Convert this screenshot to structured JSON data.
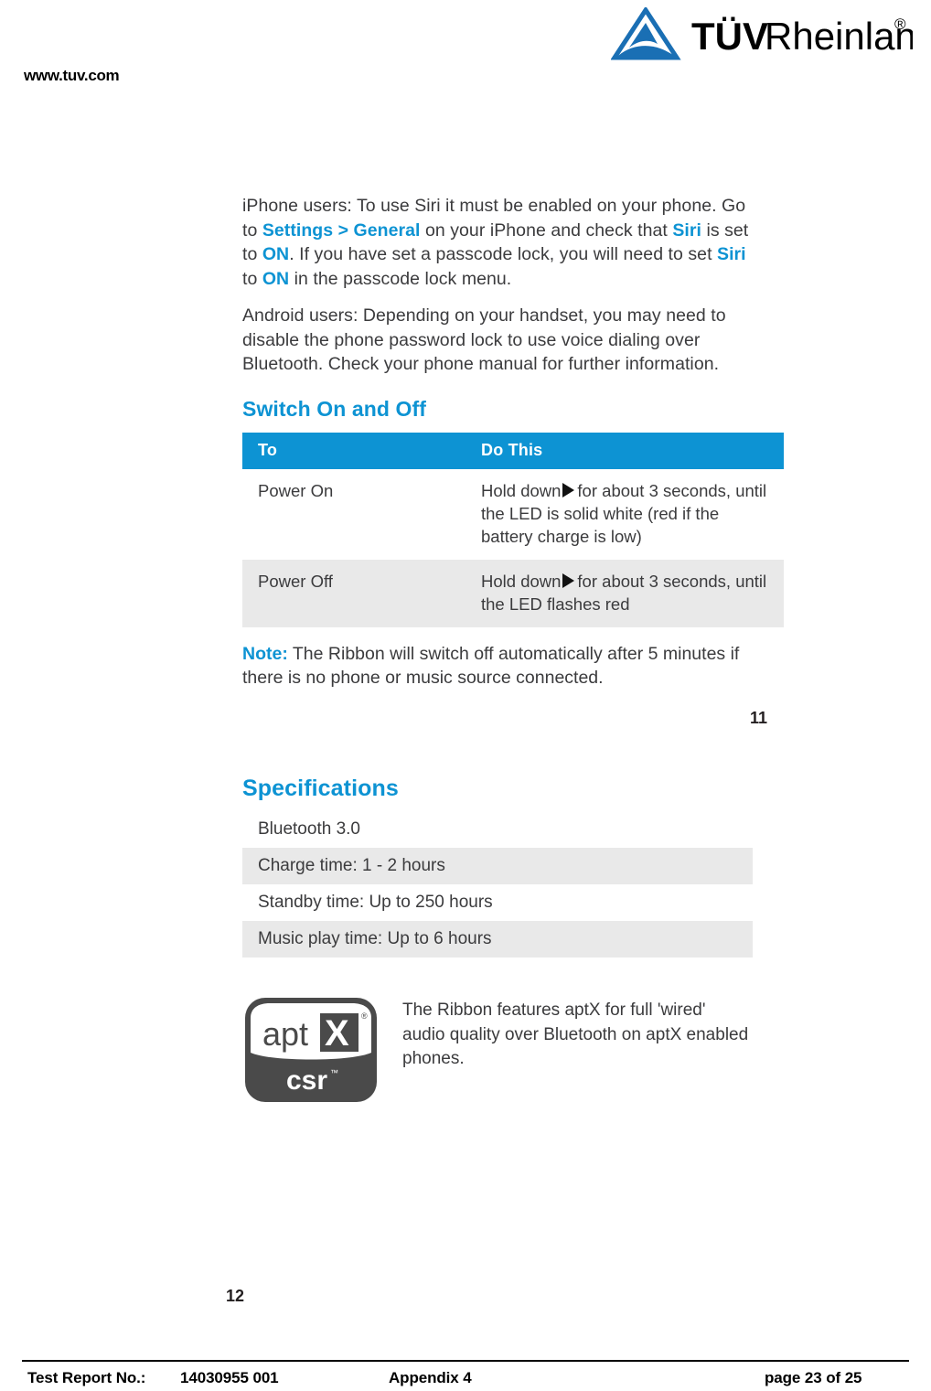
{
  "header": {
    "logo_alt": "TUV Rheinland",
    "logo_text_bold": "TÜV",
    "logo_text_regular": "Rheinland",
    "logo_registered": "®",
    "site_url": "www.tuv.com",
    "brand_color": "#1a6fb4"
  },
  "manual": {
    "accent_color": "#0d93d3",
    "shade_color": "#e9e9e9",
    "paragraphs": [
      {
        "id": "iphone-users",
        "runs": [
          {
            "text": "iPhone users: To use Siri it must be enabled on your phone. Go to ",
            "style": "normal"
          },
          {
            "text": "Settings > General",
            "style": "accent"
          },
          {
            "text": " on your iPhone and check that ",
            "style": "normal"
          },
          {
            "text": "Siri",
            "style": "accent"
          },
          {
            "text": " is set to ",
            "style": "normal"
          },
          {
            "text": "ON",
            "style": "accent"
          },
          {
            "text": ". If you have set a passcode lock, you will need to set ",
            "style": "normal"
          },
          {
            "text": "Siri",
            "style": "accent"
          },
          {
            "text": " to ",
            "style": "normal"
          },
          {
            "text": "ON",
            "style": "accent"
          },
          {
            "text": " in the passcode lock menu.",
            "style": "normal"
          }
        ]
      },
      {
        "id": "android-users",
        "runs": [
          {
            "text": "Android users: Depending on your handset, you may need to disable the phone password lock to use voice dialing over Bluetooth. Check your phone manual for further information.",
            "style": "normal"
          }
        ]
      }
    ],
    "switch_section": {
      "heading": "Switch On and Off",
      "columns": [
        "To",
        "Do This"
      ],
      "rows": [
        {
          "to": "Power On",
          "do_this_pre": "Hold down",
          "do_this_icon": "play-triangle-icon",
          "do_this_post": "for about 3 seconds, until the LED is solid white (red if the battery charge is low)"
        },
        {
          "to": "Power Off",
          "do_this_pre": "Hold down",
          "do_this_icon": "play-triangle-icon",
          "do_this_post": "for about 3 seconds, until the LED flashes red"
        }
      ]
    },
    "note": {
      "label": "Note:",
      "text": " The Ribbon will switch off automatically after 5 minutes if there is no phone or music source connected."
    },
    "folio_first": "11",
    "folio_second": "12"
  },
  "specifications": {
    "heading": "Specifications",
    "items": [
      {
        "text": "Bluetooth 3.0",
        "shaded": false
      },
      {
        "text": "Charge time: 1 - 2 hours",
        "shaded": true
      },
      {
        "text": "Standby time: Up to 250 hours",
        "shaded": false
      },
      {
        "text": "Music play time: Up to 6 hours",
        "shaded": true
      }
    ]
  },
  "aptx": {
    "logo_name": "aptx-csr-logo",
    "logo_word": "apt",
    "logo_letter": "X",
    "logo_registered": "®",
    "logo_sub": "csr",
    "description": "The Ribbon features aptX for full 'wired' audio quality over Bluetooth on aptX enabled phones."
  },
  "footer": {
    "report_label": "Test Report No.:",
    "report_number": "14030955 001",
    "appendix": "Appendix 4",
    "page": "page 23 of 25"
  }
}
